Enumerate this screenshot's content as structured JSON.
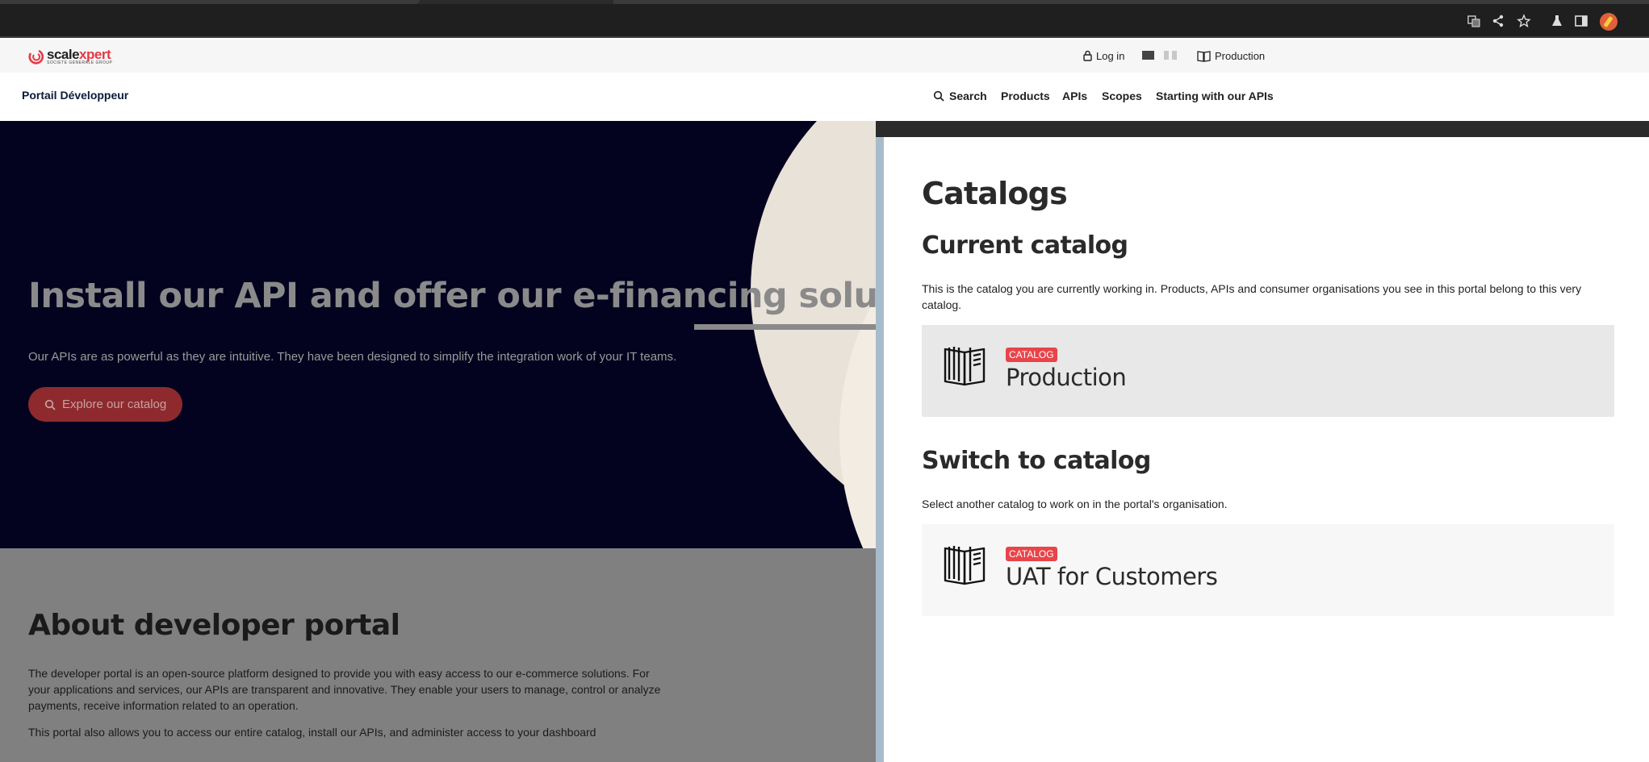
{
  "browser": {
    "icons": [
      "translate-icon",
      "share-icon",
      "bookmark-star-icon",
      "labs-flask-icon",
      "side-panel-icon",
      "profile-avatar-icon"
    ]
  },
  "utility_bar": {
    "logo_brand": "scalexpert",
    "logo_brand_accent": "xpert",
    "logo_subtitle": "SOCIETE GENERALE GROUP",
    "login_label": "Log in",
    "catalog_label": "Production"
  },
  "nav": {
    "brand_title": "Portail Développeur",
    "items": [
      "Search",
      "Products",
      "APIs",
      "Scopes",
      "Starting with our APIs"
    ]
  },
  "hero": {
    "title": "Install our API and offer our e-financing solutions to",
    "subtitle": "Our APIs are as powerful as they are intuitive. They have been designed to simplify the integration work of your IT teams.",
    "button_label": "Explore our catalog"
  },
  "about": {
    "title": "About developer portal",
    "paragraph1": "The developer portal is an open-source platform designed to provide you with easy access to our e-commerce solutions. For your applications and services, our APIs are transparent and innovative. They enable your users to manage, control or analyze payments, receive information related to an operation.",
    "paragraph2": "This portal also allows you to access our entire catalog, install our APIs, and administer access to your dashboard"
  },
  "drawer": {
    "title": "Catalogs",
    "current_heading": "Current catalog",
    "current_description": "This is the catalog you are currently working in. Products, APIs and consumer organisations you see in this portal belong to this very catalog.",
    "current_catalog": {
      "badge": "CATALOG",
      "name": "Production"
    },
    "switch_heading": "Switch to catalog",
    "switch_description": "Select another catalog to work on in the portal's organisation.",
    "other_catalogs": [
      {
        "badge": "CATALOG",
        "name": "UAT for Customers"
      }
    ]
  },
  "colors": {
    "hero_bg": "#030320",
    "accent_red": "#e8444a",
    "drawer_edge": "#a7bccb"
  }
}
